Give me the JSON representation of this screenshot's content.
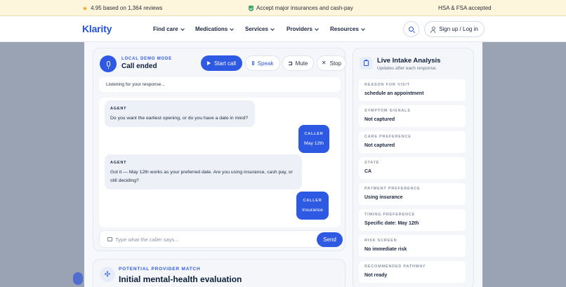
{
  "promo": {
    "rating": "4.95 based on 1,364 reviews",
    "insurance": "Accept major insurances and cash-pay",
    "hsa": "HSA & FSA accepted"
  },
  "nav": {
    "logo": "Klarity",
    "items": [
      "Find care",
      "Medications",
      "Services",
      "Providers",
      "Resources"
    ],
    "signup": "Sign up / Log in"
  },
  "call": {
    "mode_label": "LOCAL DEMO MODE",
    "title": "Call ended",
    "buttons": {
      "start": "Start call",
      "speak": "Speak",
      "mute": "Mute",
      "stop": "Stop"
    },
    "listening": "Listening for your response...",
    "messages": [
      {
        "role": "AGENT",
        "text": "Do you want the earliest opening, or do you have a date in mind?"
      },
      {
        "role": "CALLER",
        "text": "May 12th"
      },
      {
        "role": "AGENT",
        "text": "Got it — May 12th works as your preferred date. Are you using insurance, cash pay, or still deciding?"
      },
      {
        "role": "CALLER",
        "text": "Insurance"
      }
    ],
    "compose_placeholder": "Type what the caller says...",
    "send": "Send"
  },
  "provider": {
    "label": "POTENTIAL PROVIDER MATCH",
    "title": "Initial mental-health evaluation"
  },
  "intake": {
    "title": "Live Intake Analysis",
    "subtitle": "Updates after each response.",
    "fields": [
      {
        "label": "REASON FOR VISIT",
        "value": "schedule an appointment"
      },
      {
        "label": "SYMPTOM SIGNALS",
        "value": "Not captured"
      },
      {
        "label": "CARE PREFERENCE",
        "value": "Not captured"
      },
      {
        "label": "STATE",
        "value": "CA"
      },
      {
        "label": "PAYMENT PREFERENCE",
        "value": "Using insurance"
      },
      {
        "label": "TIMING PREFERENCE",
        "value": "Specific date: May 12th"
      },
      {
        "label": "RISK SCREEN",
        "value": "No immediate risk"
      },
      {
        "label": "RECOMMENDED PATHWAY",
        "value": "Not ready"
      }
    ]
  },
  "colors": {
    "accent": "#2e59e3",
    "brand": "#2553d6",
    "promo_bg": "#fdf5dc",
    "overlay": "#9aa3b3"
  }
}
